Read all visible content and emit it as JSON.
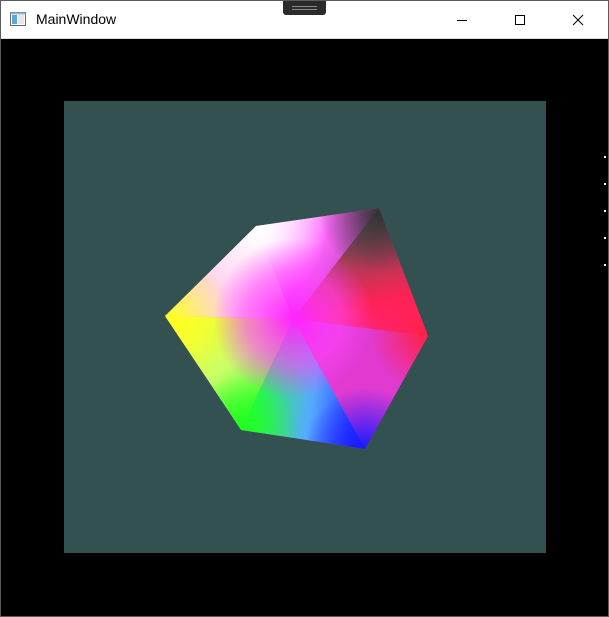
{
  "window": {
    "title": "MainWindow"
  },
  "titlebar": {
    "icons": {
      "app": "window-app-icon",
      "snap_grip": "snap-grip-icon",
      "minimize": "minimize-icon",
      "maximize": "maximize-icon",
      "close": "close-icon"
    }
  },
  "scene": {
    "clear_color": "#000000",
    "quad_color": "#325150",
    "vertex_colors": {
      "white": "#ffffff",
      "yellow": "#ffff22",
      "magenta": "#ff22ff",
      "red": "#ff2255",
      "green": "#22ff22",
      "blue": "#1a1aff",
      "dark": "#444444"
    }
  }
}
